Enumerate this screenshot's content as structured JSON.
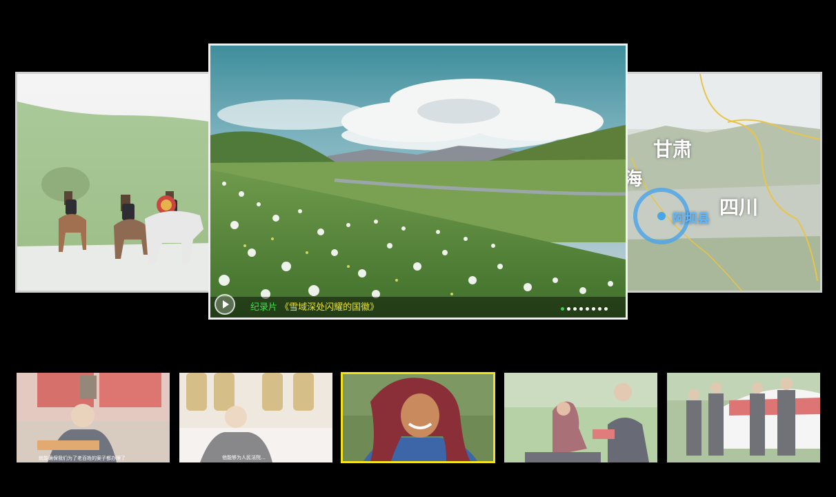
{
  "carousel": {
    "main": {
      "caption_lead": "纪录片",
      "caption_title": "《雪域深处闪耀的国徽》",
      "play_icon": "play-icon",
      "dots": {
        "total": 8,
        "active_index": 0
      }
    },
    "right_slide": {
      "map_labels": {
        "gansu": "甘肃",
        "hai": "海",
        "sichuan": "四川",
        "aba": "阿坝县"
      }
    }
  },
  "thumbnails": [
    {
      "id": "thumb-1",
      "subtitle": "就能确保我们为了老百姓的案子都办理了"
    },
    {
      "id": "thumb-2",
      "subtitle": "他能够为人民法院…"
    },
    {
      "id": "thumb-3",
      "subtitle": ""
    },
    {
      "id": "thumb-4",
      "subtitle": ""
    },
    {
      "id": "thumb-5",
      "subtitle": ""
    }
  ],
  "colors": {
    "selected_border": "#f3e21b",
    "caption_title": "#e8e03a",
    "caption_lead": "#3be34a",
    "dot_active": "#3ad04a"
  }
}
